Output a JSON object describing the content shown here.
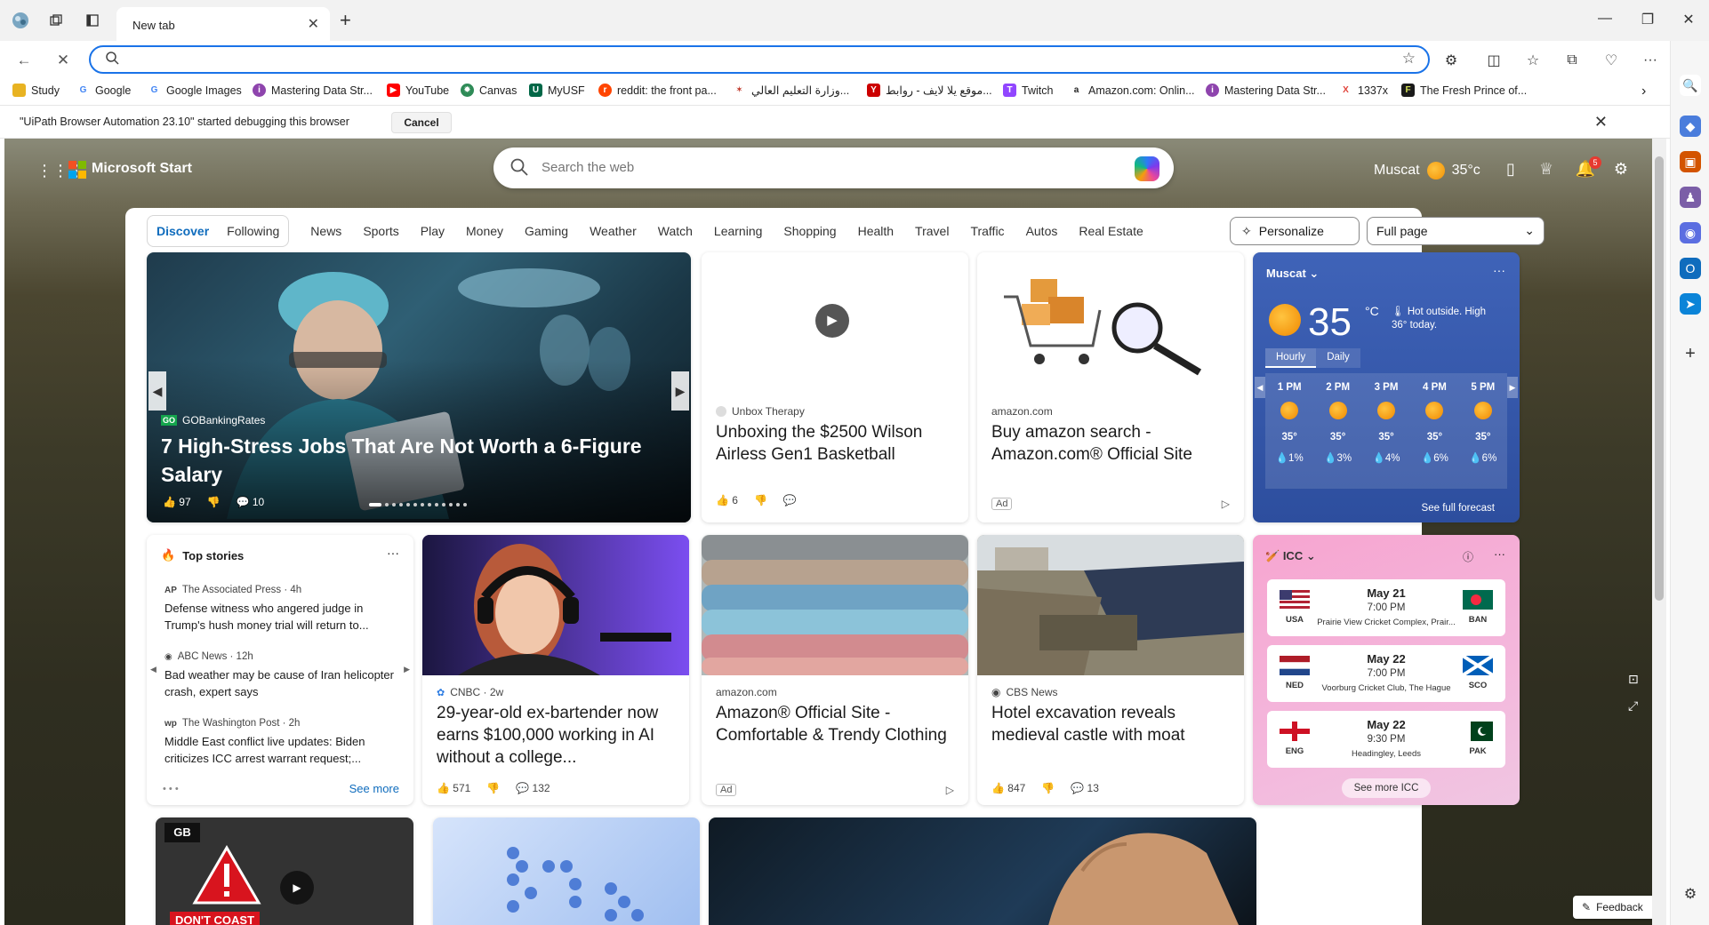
{
  "browser": {
    "tab_title": "New tab",
    "address_value": "",
    "bookmarks": [
      {
        "label": "Study",
        "icon": "folder-icon",
        "color": "#e8b322"
      },
      {
        "label": "Google",
        "icon": "google-icon",
        "color": "#4285f4"
      },
      {
        "label": "Google Images",
        "icon": "google-icon",
        "color": "#4285f4"
      },
      {
        "label": "Mastering Data Str...",
        "icon": "course-icon",
        "color": "#8e44ad"
      },
      {
        "label": "YouTube",
        "icon": "youtube-icon",
        "color": "#ff0000"
      },
      {
        "label": "Canvas",
        "icon": "canvas-icon",
        "color": "#2e8b57"
      },
      {
        "label": "MyUSF",
        "icon": "usf-icon",
        "color": "#006747"
      },
      {
        "label": "reddit: the front pa...",
        "icon": "reddit-icon",
        "color": "#ff4500"
      },
      {
        "label": "وزارة التعليم العالي...",
        "icon": "ministry-icon",
        "color": "#c0392b"
      },
      {
        "label": "موقع يلا لايف - روابط...",
        "icon": "yalla-icon",
        "color": "#cc0000"
      },
      {
        "label": "Twitch",
        "icon": "twitch-icon",
        "color": "#9146ff"
      },
      {
        "label": "Amazon.com: Onlin...",
        "icon": "amazon-icon",
        "color": "#222222"
      },
      {
        "label": "Mastering Data Str...",
        "icon": "course-icon",
        "color": "#8e44ad"
      },
      {
        "label": "1337x",
        "icon": "x-icon",
        "color": "#e0433a"
      },
      {
        "label": "The Fresh Prince of...",
        "icon": "freshprince-icon",
        "color": "#1a1a1a"
      }
    ],
    "infobar_text": "\"UiPath Browser Automation 23.10\" started debugging this browser",
    "infobar_cancel": "Cancel"
  },
  "start": {
    "brand": "Microsoft Start",
    "search_placeholder": "Search the web",
    "location": "Muscat",
    "temp": "35°c",
    "notif_count": "5"
  },
  "feed_nav": {
    "tabs": [
      "Discover",
      "Following"
    ],
    "categories": [
      "News",
      "Sports",
      "Play",
      "Money",
      "Gaming",
      "Weather",
      "Watch",
      "Learning",
      "Shopping",
      "Health",
      "Travel",
      "Traffic",
      "Autos",
      "Real Estate"
    ],
    "personalize": "Personalize",
    "layout": "Full page"
  },
  "hero": {
    "source": "GOBankingRates",
    "title": "7 High-Stress Jobs That Are Not Worth a 6-Figure Salary",
    "likes": "97",
    "comments": "10"
  },
  "card_video": {
    "source": "Unbox Therapy",
    "title": "Unboxing the $2500 Wilson Airless Gen1 Basketball",
    "likes": "6"
  },
  "card_amazon1": {
    "source": "amazon.com",
    "title": "Buy amazon search - Amazon.com® Official Site",
    "ad": "Ad"
  },
  "weather": {
    "location": "Muscat",
    "temp": "35",
    "unit": "°C",
    "desc": "Hot outside. High 36° today.",
    "tab_hourly": "Hourly",
    "tab_daily": "Daily",
    "hours": [
      {
        "time": "1 PM",
        "temp": "35°",
        "precip": "1%"
      },
      {
        "time": "2 PM",
        "temp": "35°",
        "precip": "3%"
      },
      {
        "time": "3 PM",
        "temp": "35°",
        "precip": "4%"
      },
      {
        "time": "4 PM",
        "temp": "35°",
        "precip": "6%"
      },
      {
        "time": "5 PM",
        "temp": "35°",
        "precip": "6%"
      }
    ],
    "full_forecast": "See full forecast"
  },
  "top_stories": {
    "title": "Top stories",
    "items": [
      {
        "source": "The Associated Press · 4h",
        "title": "Defense witness who angered judge in Trump's hush money trial will return to..."
      },
      {
        "source": "ABC News · 12h",
        "title": "Bad weather may be cause of Iran helicopter crash, expert says"
      },
      {
        "source": "The Washington Post · 2h",
        "title": "Middle East conflict live updates: Biden criticizes ICC arrest warrant request;..."
      }
    ],
    "see_more": "See more"
  },
  "card_cnbc": {
    "source": "CNBC · 2w",
    "title": "29-year-old ex-bartender now earns $100,000 working in AI without a college...",
    "likes": "571",
    "comments": "132"
  },
  "card_amazon2": {
    "source": "amazon.com",
    "title": "Amazon® Official Site - Comfortable & Trendy Clothing",
    "ad": "Ad"
  },
  "card_cbs": {
    "source": "CBS News",
    "title": "Hotel excavation reveals medieval castle with moat",
    "likes": "847",
    "comments": "13"
  },
  "icc": {
    "title": "ICC",
    "matches": [
      {
        "date": "May 21",
        "time": "7:00 PM",
        "venue": "Prairie View Cricket Complex, Prair...",
        "team1": "USA",
        "team2": "BAN"
      },
      {
        "date": "May 22",
        "time": "7:00 PM",
        "venue": "Voorburg Cricket Club, The Hague",
        "team1": "NED",
        "team2": "SCO"
      },
      {
        "date": "May 22",
        "time": "9:30 PM",
        "venue": "Headingley, Leeds",
        "team1": "ENG",
        "team2": "PAK"
      }
    ],
    "see_more": "See more ICC"
  },
  "bottom_cards": [
    "GB",
    "DON'T COAST"
  ],
  "feedback": "Feedback"
}
